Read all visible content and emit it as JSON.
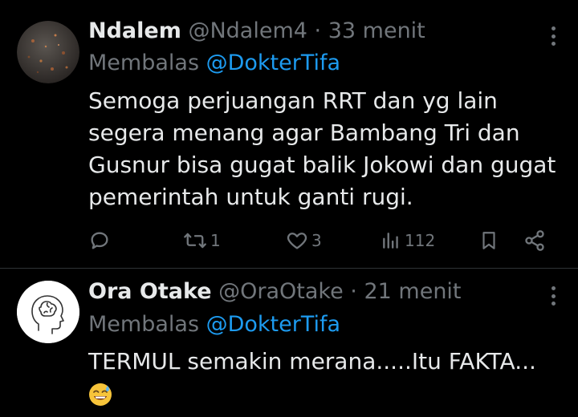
{
  "tweets": [
    {
      "author_name": "Ndalem",
      "handle": "@Ndalem4",
      "separator": "·",
      "time": "33 menit",
      "reply_prefix": "Membalas",
      "reply_to": "@DokterTifa",
      "text_lines": [
        "Semoga perjuangan RRT dan yg lain",
        "segera menang agar Bambang Tri dan",
        "Gusnur bisa gugat balik Jokowi dan gugat",
        "pemerintah untuk ganti rugi."
      ],
      "stats": {
        "retweets": "1",
        "likes": "3",
        "views": "112"
      }
    },
    {
      "author_name": "Ora Otake",
      "handle": "@OraOtake",
      "separator": "·",
      "time": "21 menit",
      "reply_prefix": "Membalas",
      "reply_to": "@DokterTifa",
      "text_lines": [
        "TERMUL semakin merana.....Itu FAKTA..."
      ],
      "emoji": "sweat-smile-emoji"
    }
  ],
  "colors": {
    "background": "#000000",
    "text": "#e7e9ea",
    "secondary": "#71767b",
    "accent": "#1d9bf0",
    "divider": "#2f3336"
  },
  "icons": [
    "reply-icon",
    "retweet-icon",
    "like-icon",
    "views-icon",
    "bookmark-icon",
    "share-icon",
    "more-icon"
  ]
}
